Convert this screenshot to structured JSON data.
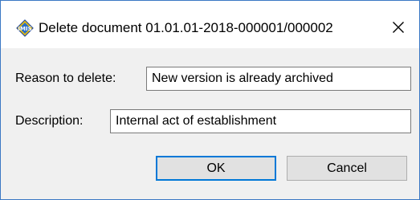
{
  "window": {
    "title": "Delete document 01.01.01-2018-000001/000002",
    "app_icon": "imis-logo-icon",
    "close_glyph": "✕"
  },
  "form": {
    "reason_label": "Reason to delete:",
    "reason_value": "New version is already archived",
    "description_label": "Description:",
    "description_value": "Internal act of establishment"
  },
  "buttons": {
    "ok_label": "OK",
    "cancel_label": "Cancel"
  },
  "colors": {
    "accent": "#0078d7",
    "window_border": "#3b78c4",
    "dialog_bg": "#f0f0f0"
  }
}
